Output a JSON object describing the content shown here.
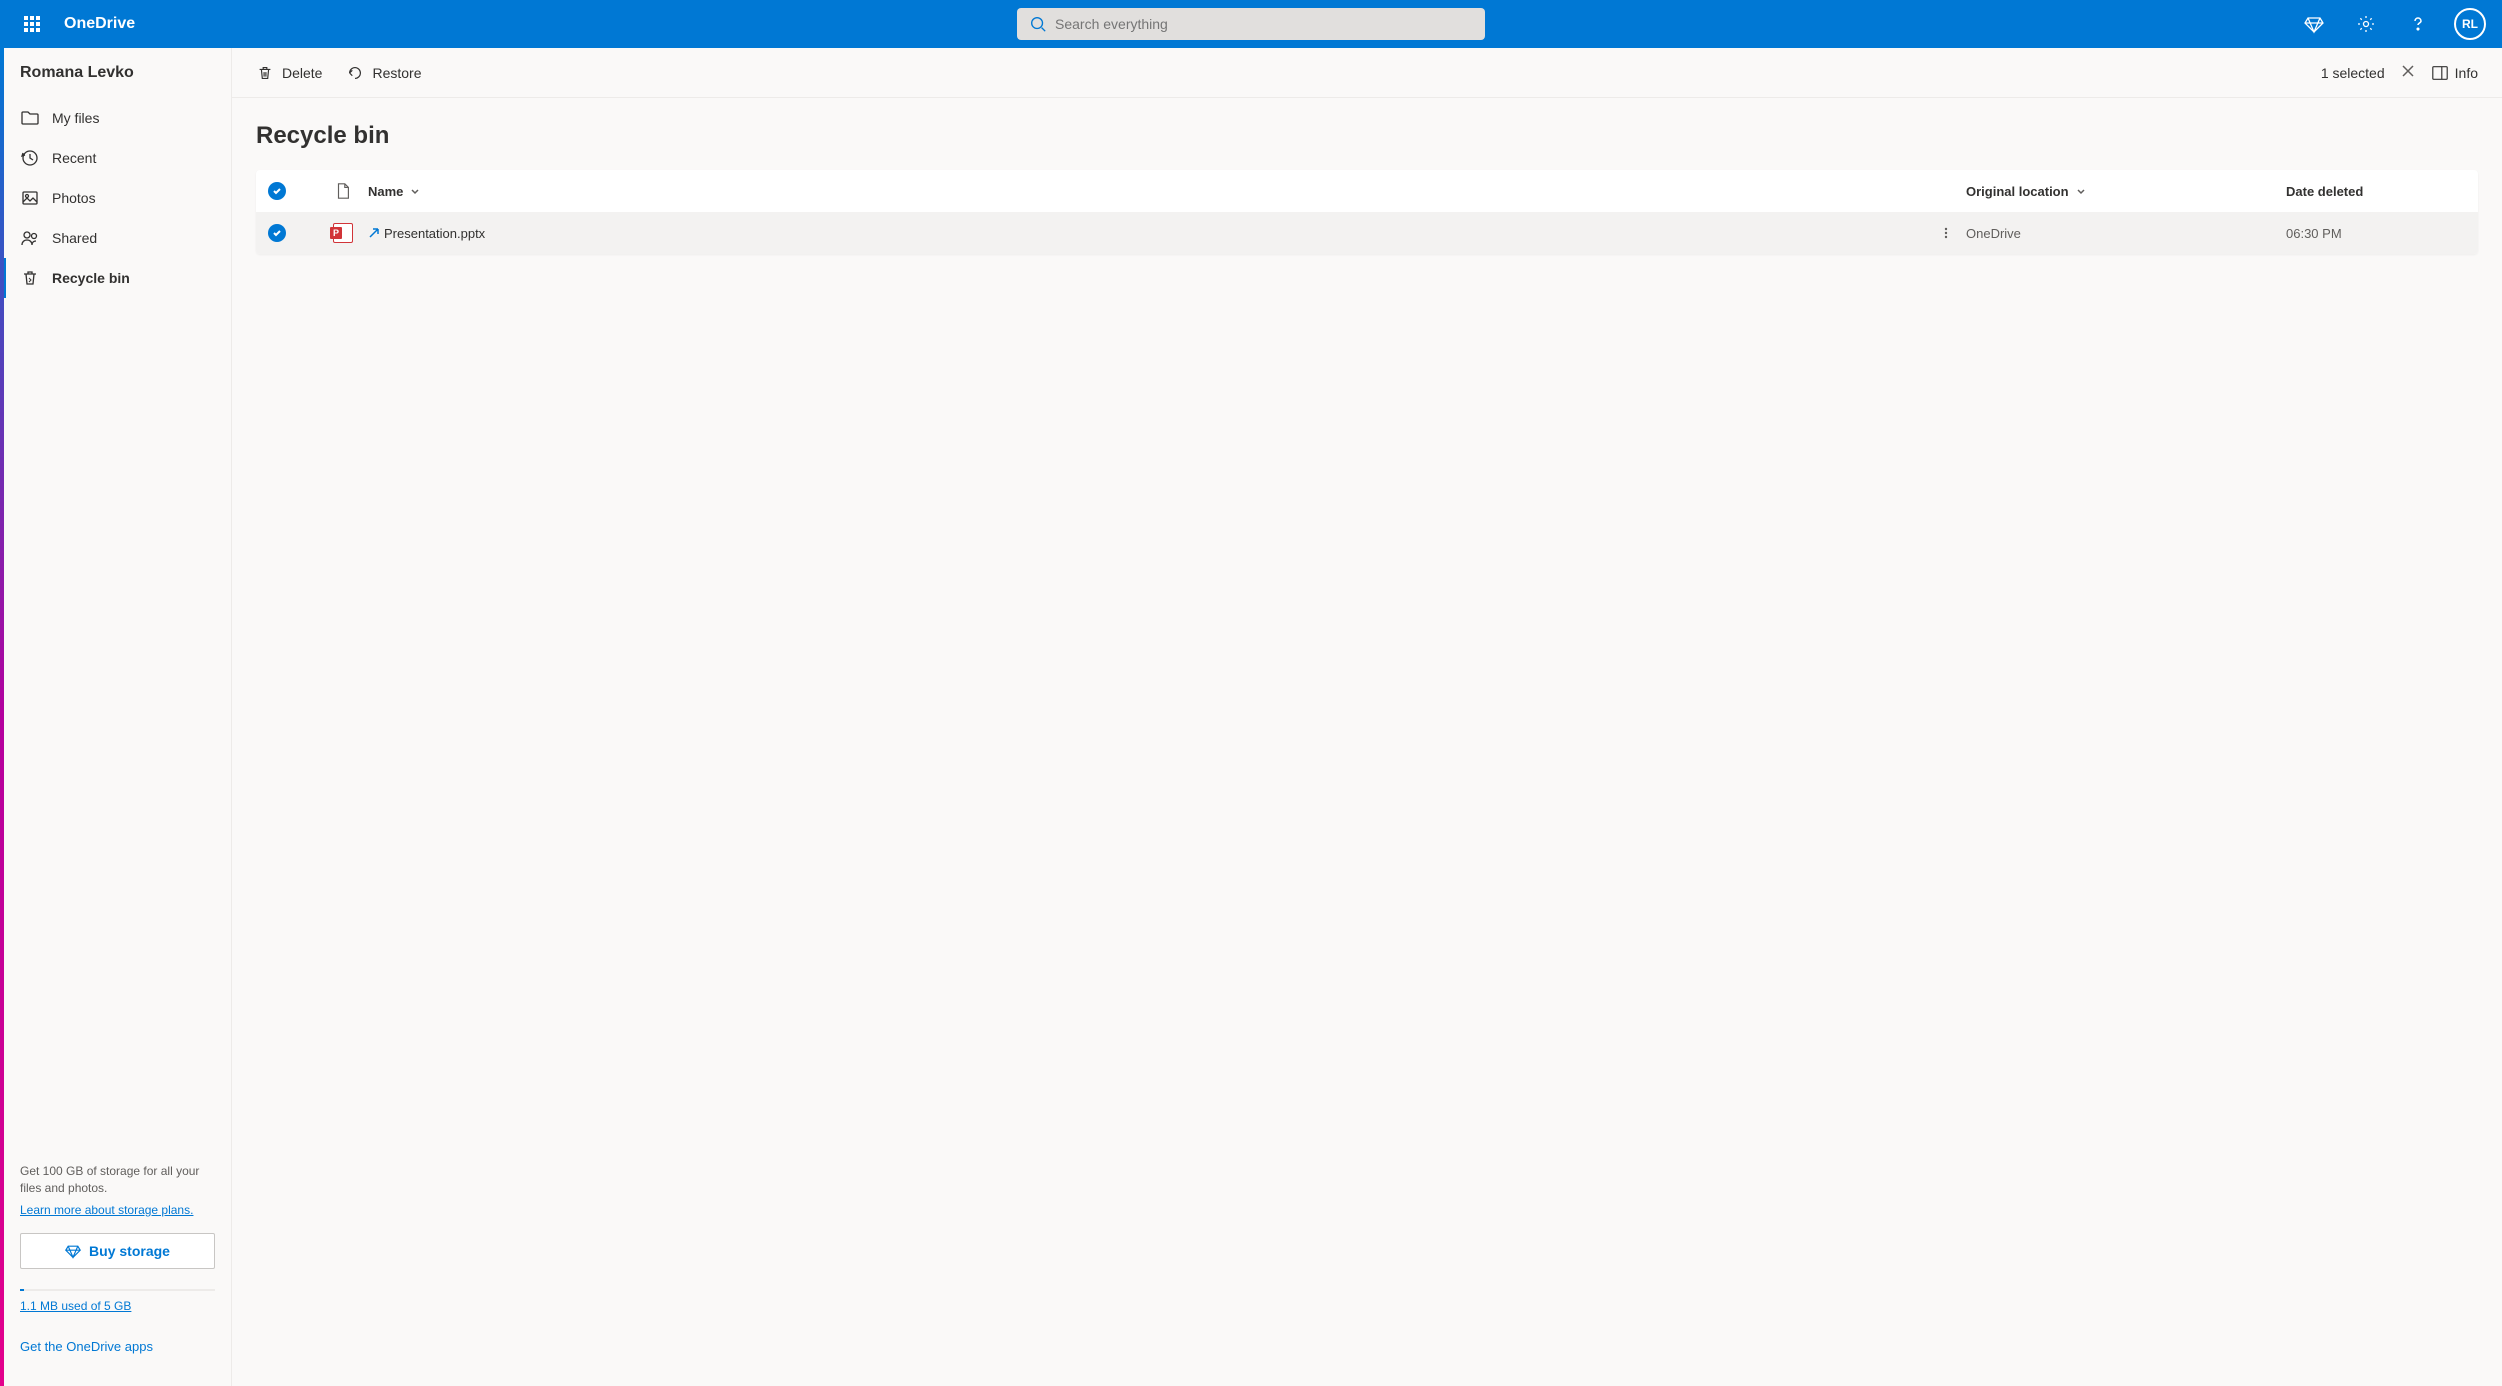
{
  "header": {
    "brand": "OneDrive",
    "search_placeholder": "Search everything",
    "avatar_initials": "RL"
  },
  "sidebar": {
    "user_name": "Romana Levko",
    "nav": [
      {
        "label": "My files"
      },
      {
        "label": "Recent"
      },
      {
        "label": "Photos"
      },
      {
        "label": "Shared"
      },
      {
        "label": "Recycle bin"
      }
    ],
    "storage_promo": "Get 100 GB of storage for all your files and photos.",
    "storage_learn_more": "Learn more about storage plans.",
    "buy_storage_label": "Buy storage",
    "storage_used": "1.1 MB used of 5 GB",
    "get_apps": "Get the OneDrive apps"
  },
  "toolbar": {
    "delete_label": "Delete",
    "restore_label": "Restore",
    "selection_text": "1 selected",
    "info_label": "Info"
  },
  "page": {
    "title": "Recycle bin"
  },
  "table": {
    "columns": {
      "name": "Name",
      "location": "Original location",
      "deleted": "Date deleted"
    },
    "rows": [
      {
        "name": "Presentation.pptx",
        "location": "OneDrive",
        "deleted": "06:30 PM"
      }
    ]
  }
}
